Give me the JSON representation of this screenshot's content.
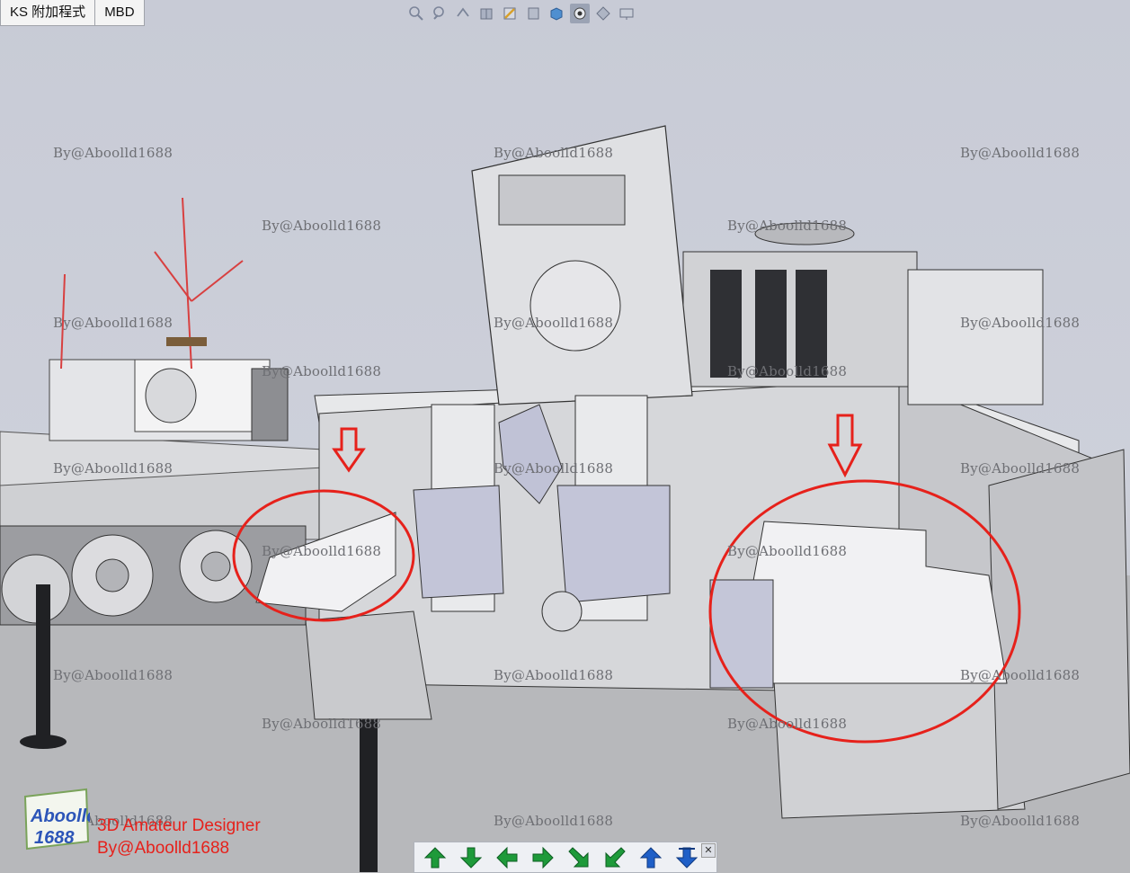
{
  "tabs": [
    {
      "label": "KS 附加程式"
    },
    {
      "label": "MBD"
    }
  ],
  "view_toolbar": {
    "icons": [
      "zoom-to-fit-icon",
      "zoom-area-icon",
      "previous-view-icon",
      "section-view-icon",
      "view-orientation-icon",
      "display-style-icon",
      "hide-show-icon",
      "edit-appearance-icon",
      "apply-scene-icon",
      "view-settings-icon"
    ]
  },
  "watermarks": [
    "By@Aboolld1688"
  ],
  "brand": {
    "logo_line1": "Aboolld",
    "logo_line2": "1688",
    "line1": "3D Amateur Designer",
    "line2": "By@Aboolld1688"
  },
  "navigation": {
    "buttons": [
      "move-up-icon",
      "move-down-icon",
      "move-left-icon",
      "move-right-icon",
      "rotate-down-right-icon",
      "rotate-down-left-icon",
      "previous-icon",
      "next-icon"
    ],
    "close_label": "✕"
  },
  "colors": {
    "annotation": "#e6211b",
    "nav_green": "#1e9a3a",
    "nav_blue": "#1f5fc7"
  }
}
